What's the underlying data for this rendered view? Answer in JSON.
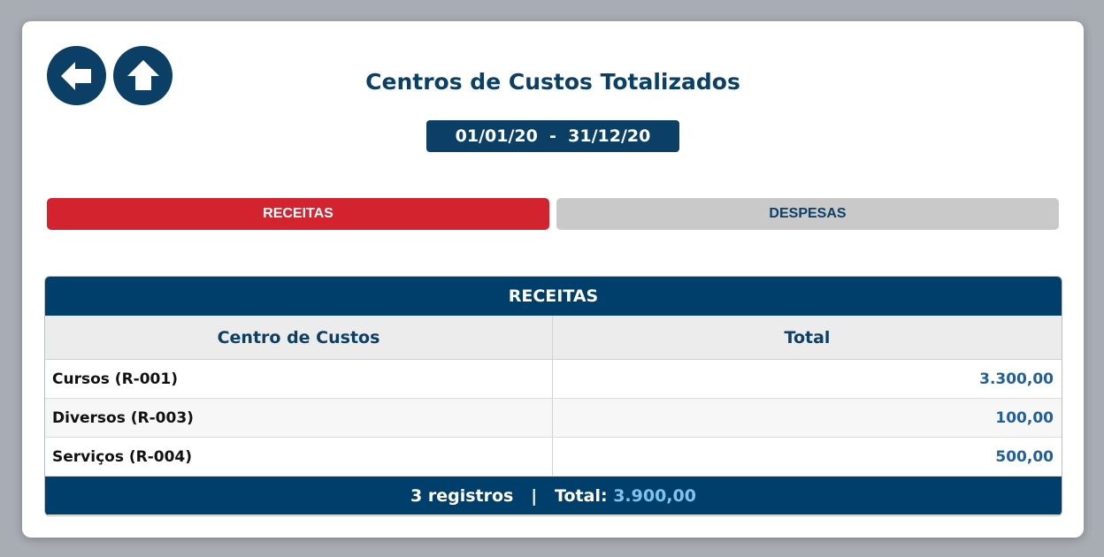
{
  "header": {
    "title": "Centros de Custos Totalizados",
    "date_range": "01/01/20  -  31/12/20",
    "back_icon": "arrow-left-icon",
    "home_icon": "arrow-up-home-icon"
  },
  "tabs": [
    {
      "label": "RECEITAS",
      "active": true
    },
    {
      "label": "DESPESAS",
      "active": false
    }
  ],
  "table": {
    "title": "RECEITAS",
    "columns": [
      "Centro de Custos",
      "Total"
    ],
    "rows": [
      {
        "name": "Cursos (R-001)",
        "total": "3.300,00"
      },
      {
        "name": "Diversos (R-003)",
        "total": "100,00"
      },
      {
        "name": "Serviços (R-004)",
        "total": "500,00"
      }
    ],
    "footer": {
      "count": "3 registros",
      "separator": "|",
      "total_label": "Total:",
      "total_value": "3.900,00"
    }
  },
  "colors": {
    "primary": "#0b3f66",
    "active_tab": "#d3232f",
    "inactive_tab": "#c9c9c9",
    "value_text": "#1f5f9a",
    "footer_total": "#7fc4ee"
  }
}
